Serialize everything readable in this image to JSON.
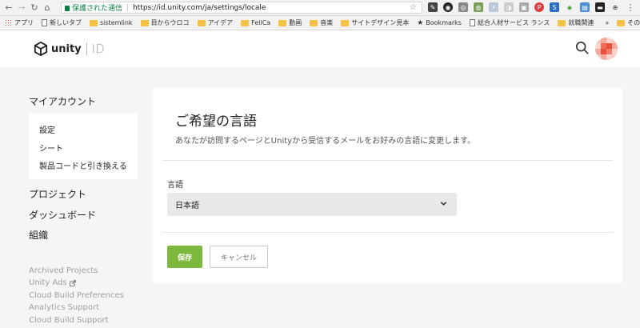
{
  "browser": {
    "secure_label": "保護された通信",
    "url": "https://id.unity.com/ja/settings/locale",
    "bookmarks": [
      {
        "label": "アプリ",
        "kind": "apps"
      },
      {
        "label": "新しいタブ",
        "kind": "page"
      },
      {
        "label": "sistemlink",
        "kind": "folder"
      },
      {
        "label": "目からウロコ",
        "kind": "folder"
      },
      {
        "label": "アイデア",
        "kind": "folder"
      },
      {
        "label": "FeliCa",
        "kind": "folder"
      },
      {
        "label": "動画",
        "kind": "folder"
      },
      {
        "label": "音楽",
        "kind": "folder"
      },
      {
        "label": "サイトデザイン見本",
        "kind": "folder"
      },
      {
        "label": "Bookmarks",
        "kind": "star"
      },
      {
        "label": "総合人材サービス ランス",
        "kind": "page"
      },
      {
        "label": "就職関連",
        "kind": "folder"
      }
    ],
    "bookmarks_overflow": "»",
    "other_bookmarks": "その他のブックマーク"
  },
  "header": {
    "logo_text": "unity",
    "logo_suffix": "ID"
  },
  "sidebar": {
    "account_title": "マイアカウント",
    "sub_items": [
      "設定",
      "シート",
      "製品コードと引き換える"
    ],
    "links": [
      "プロジェクト",
      "ダッシュボード",
      "組織"
    ],
    "footer_links": [
      "Archived Projects",
      "Unity Ads",
      "Cloud Build Preferences",
      "Analytics Support",
      "Cloud Build Support"
    ]
  },
  "main": {
    "title": "ご希望の言語",
    "description": "あなたが訪問するページとUnityから受信するメールをお好みの言語に変更します。",
    "field_label": "言語",
    "selected_language": "日本語",
    "save_label": "保存",
    "cancel_label": "キャンセル"
  },
  "colors": {
    "accent_green": "#7cb83c",
    "page_bg": "#f5f5f5",
    "muted_link": "#a0a0a0"
  }
}
